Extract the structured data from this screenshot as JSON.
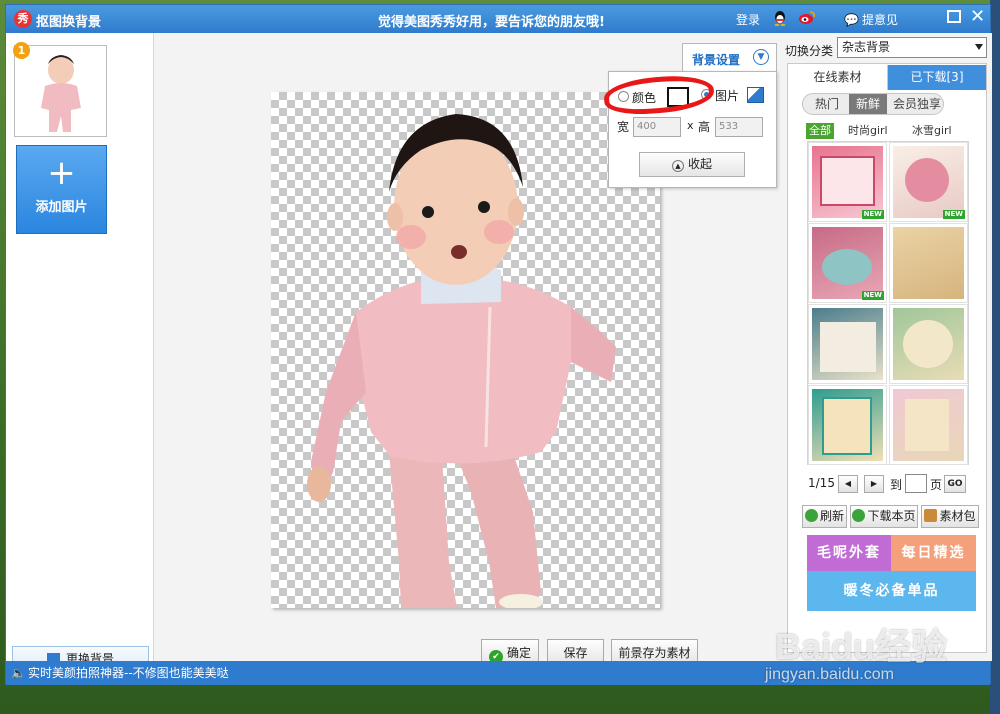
{
  "window": {
    "title": "抠图换背景",
    "logo_glyph": "秀",
    "slogan": "觉得美图秀秀好用，要告诉您的朋友哦!",
    "login": "登录",
    "feedback": "提意见",
    "close_glyph": "✕"
  },
  "left_panel": {
    "thumb_index": "1",
    "add_image_plus": "+",
    "add_image_label": "添加图片",
    "change_bg_label": "更换背景"
  },
  "bg_settings": {
    "title": "背景设置",
    "color_label": "颜色",
    "image_label": "图片",
    "width_label": "宽",
    "times": "x",
    "height_label": "高",
    "width_value": "400",
    "height_value": "533",
    "collapse_label": "收起",
    "selected": "图片"
  },
  "bottom_buttons": {
    "confirm": "确定",
    "save": "保存",
    "save_foreground": "前景存为素材"
  },
  "right_panel": {
    "switch_label": "切换分类",
    "category_value": "杂志背景",
    "tab_online": "在线素材",
    "tab_downloaded": "已下载[3]",
    "subtabs": [
      "热门",
      "新鲜",
      "会员独享"
    ],
    "active_subtab": "新鲜",
    "filters": [
      "全部",
      "时尚girl",
      "冰雪girl"
    ],
    "tiles": [
      {
        "new": "NEW"
      },
      {
        "new": "NEW"
      },
      {
        "new": "NEW"
      },
      {
        "new": ""
      },
      {
        "new": ""
      },
      {
        "new": ""
      },
      {
        "new": ""
      },
      {
        "new": ""
      }
    ],
    "page_info": "1/15",
    "prev": "◀",
    "next": "▶",
    "goto_label": "到",
    "page_unit": "页",
    "go": "GO",
    "refresh": "刷新",
    "download_page": "下载本页",
    "material_pack": "素材包",
    "banners": {
      "b1": "毛呢外套",
      "b2": "每日精选",
      "b3": "暖冬必备单品"
    }
  },
  "statusbar": {
    "text": "实时美颜拍照神器--不修图也能美美哒"
  },
  "watermark": {
    "line1": "Baidu经验",
    "line2": "jingyan.baidu.com"
  },
  "colors": {
    "title_bar": "#2f7bcd",
    "accent_blue": "#3f8fdc",
    "new_badge": "#2fa52f",
    "annotation_red": "#e81818"
  }
}
